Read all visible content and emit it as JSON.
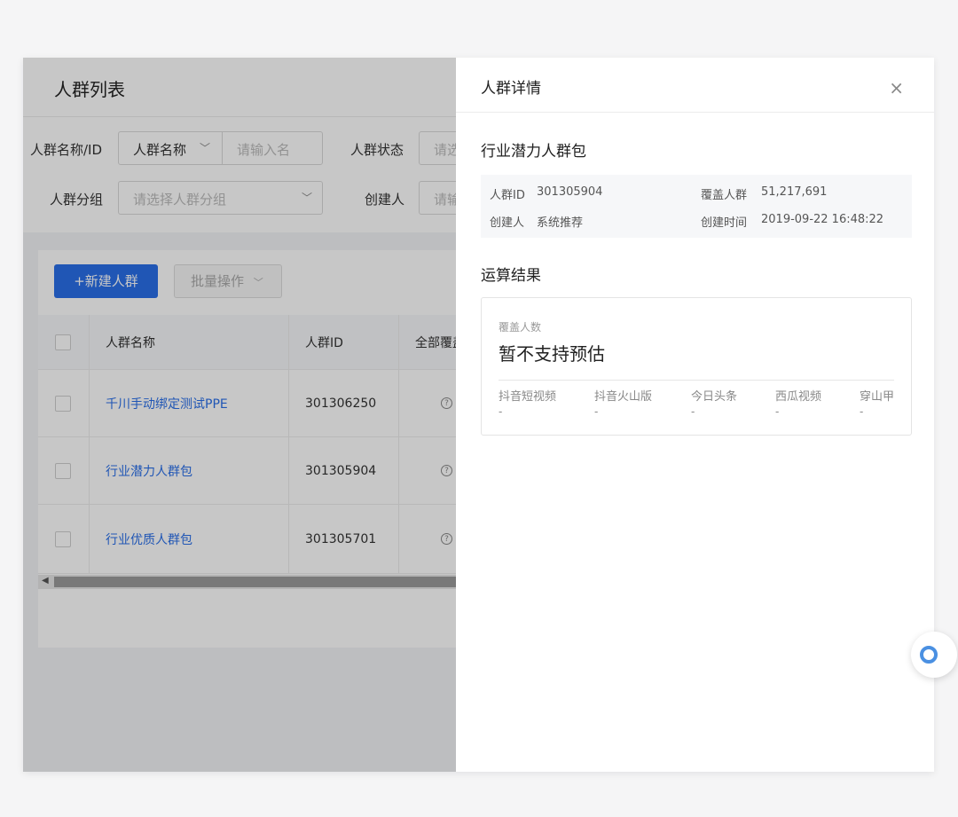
{
  "page": {
    "title": "人群列表"
  },
  "filters": {
    "name_id_label": "人群名称/ID",
    "name_type_select": "人群名称",
    "name_input_placeholder": "请输入名",
    "status_label": "人群状态",
    "status_placeholder": "请选",
    "group_label": "人群分组",
    "group_placeholder": "请选择人群分组",
    "creator_label": "创建人",
    "creator_placeholder": "请输"
  },
  "toolbar": {
    "new_label": "+新建人群",
    "batch_label": "批量操作"
  },
  "table": {
    "columns": [
      "人群名称",
      "人群ID",
      "全部覆盖"
    ],
    "rows": [
      {
        "name": "千川手动绑定测试PPE",
        "id": "301306250",
        "help": "?"
      },
      {
        "name": "行业潜力人群包",
        "id": "301305904",
        "help": "?"
      },
      {
        "name": "行业优质人群包",
        "id": "301305701",
        "help": "?"
      }
    ]
  },
  "drawer": {
    "title": "人群详情",
    "close_glyph": "×",
    "audience_name": "行业潜力人群包",
    "info": {
      "id_label": "人群ID",
      "id_value": "301305904",
      "coverage_label": "覆盖人群",
      "coverage_value": "51,217,691",
      "creator_label": "创建人",
      "creator_value": "系统推荐",
      "created_label": "创建时间",
      "created_value": "2019-09-22 16:48:22"
    },
    "result_title": "运算结果",
    "result": {
      "coverage_label": "覆盖人数",
      "coverage_value": "暂不支持预估",
      "platforms": [
        {
          "name": "抖音短视频",
          "value": "-"
        },
        {
          "name": "抖音火山版",
          "value": "-"
        },
        {
          "name": "今日头条",
          "value": "-"
        },
        {
          "name": "西瓜视频",
          "value": "-"
        },
        {
          "name": "穿山甲",
          "value": "-"
        }
      ]
    }
  },
  "colors": {
    "primary": "#2a6fe8",
    "link": "#2a6fe8"
  }
}
